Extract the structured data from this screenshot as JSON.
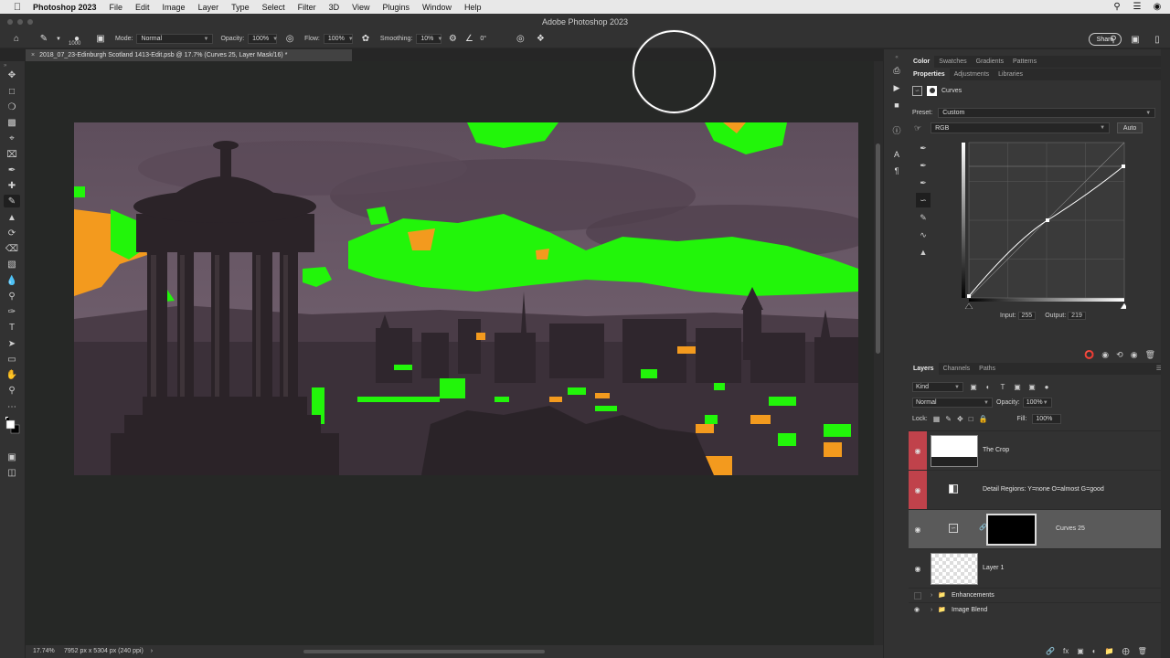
{
  "menubar": {
    "app": "Photoshop 2023",
    "items": [
      "File",
      "Edit",
      "Image",
      "Layer",
      "Type",
      "Select",
      "Filter",
      "3D",
      "View",
      "Plugins",
      "Window",
      "Help"
    ]
  },
  "window_title": "Adobe Photoshop 2023",
  "options": {
    "brush_size": "1000",
    "mode_label": "Mode:",
    "mode_value": "Normal",
    "opacity_label": "Opacity:",
    "opacity_value": "100%",
    "flow_label": "Flow:",
    "flow_value": "100%",
    "smoothing_label": "Smoothing:",
    "smoothing_value": "10%",
    "angle_value": "0°",
    "share_label": "Share"
  },
  "document": {
    "tab_title": "2018_07_23-Edinburgh Scotland 1413-Edit.psb @ 17.7% (Curves 25, Layer Mask/16) *"
  },
  "status": {
    "zoom": "17.74%",
    "info": "7952 px x 5304 px (240 ppi)"
  },
  "panels": {
    "top_tabs": [
      "Color",
      "Swatches",
      "Gradients",
      "Patterns"
    ],
    "prop_tabs": [
      "Properties",
      "Adjustments",
      "Libraries"
    ],
    "prop_title": "Curves",
    "preset_label": "Preset:",
    "preset_value": "Custom",
    "channel_value": "RGB",
    "auto_label": "Auto",
    "input_label": "Input:",
    "input_value": "255",
    "output_label": "Output:",
    "output_value": "219"
  },
  "layers_panel": {
    "tabs": [
      "Layers",
      "Channels",
      "Paths"
    ],
    "filter_kind": "Kind",
    "blend_mode": "Normal",
    "opacity_label": "Opacity:",
    "opacity_value": "100%",
    "lock_label": "Lock:",
    "fill_label": "Fill:",
    "fill_value": "100%",
    "layers": [
      {
        "name": "The Crop"
      },
      {
        "name": "Detail Regions: Y=none O=almost G=good"
      },
      {
        "name": "Curves 25"
      },
      {
        "name": "Layer 1"
      }
    ],
    "groups": [
      {
        "name": "Enhancements"
      },
      {
        "name": "Image Blend"
      }
    ]
  },
  "colors": {
    "accent_red": "#c0424b",
    "overlay_green": "#22f50a",
    "overlay_orange": "#f39a1e"
  }
}
